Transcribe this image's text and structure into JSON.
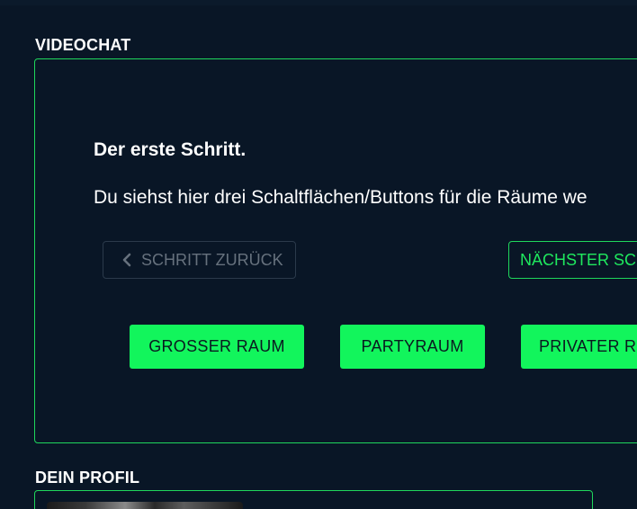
{
  "sections": {
    "videochat_title": "VIDEOCHAT",
    "profile_title": "DEIN PROFIL"
  },
  "tutorial": {
    "step_title": "Der erste Schritt.",
    "step_text": "Du siehst hier drei Schaltflächen/Buttons für die Räume we",
    "back_label": "SCHRITT ZURÜCK",
    "next_label": "NÄCHSTER SC"
  },
  "rooms": {
    "big_room_label": "GROSSER RAUM",
    "party_room_label": "PARTYRAUM",
    "private_room_label": "PRIVATER R"
  },
  "icons": {
    "back": "chevron-left-icon"
  },
  "colors": {
    "background": "#091626",
    "accent_green": "#12f55c",
    "border_green": "#1fd75c",
    "disabled_text": "#66717d"
  }
}
